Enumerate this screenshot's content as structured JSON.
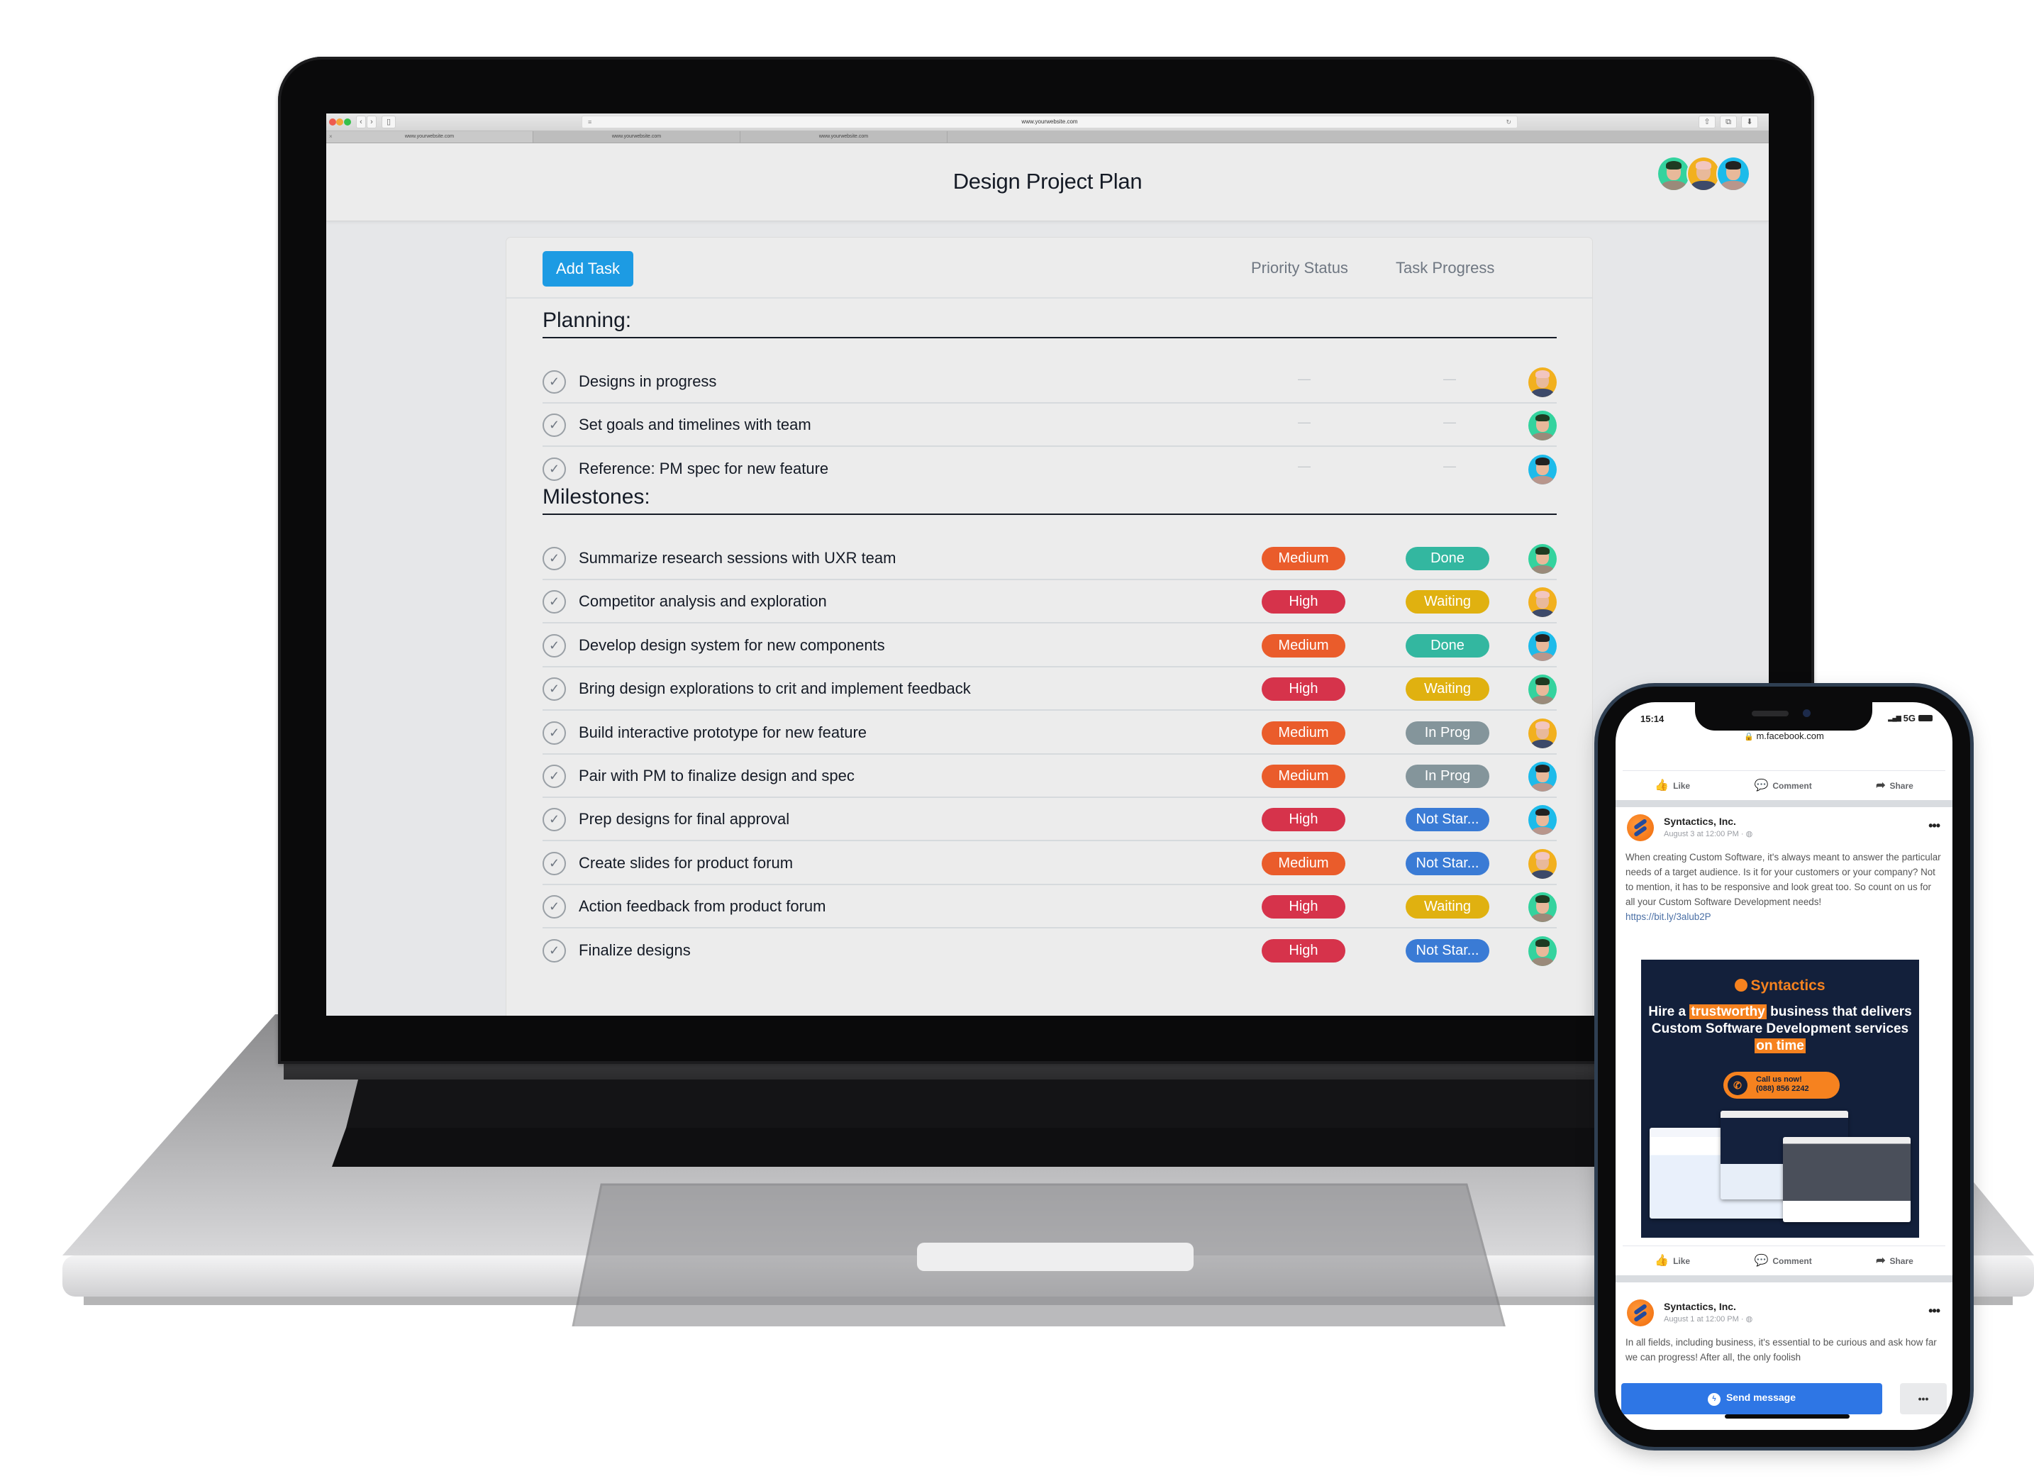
{
  "browser": {
    "address": "www.yourwebsite.com",
    "tabs": [
      {
        "label": "www.yourwebsite.com",
        "active": true
      },
      {
        "label": "www.yourwebsite.com",
        "active": false
      },
      {
        "label": "www.yourwebsite.com",
        "active": false
      }
    ],
    "icons": {
      "back": "‹",
      "forward": "›",
      "sidebar": "▯",
      "reader": "≡",
      "reload": "↻",
      "share": "⇧",
      "tabs": "⧉",
      "download": "⬇",
      "tab_close": "×"
    }
  },
  "app": {
    "title": "Design Project Plan",
    "add_task_label": "Add Task",
    "columns": {
      "priority": "Priority Status",
      "progress": "Task Progress"
    },
    "empty_placeholder": "—",
    "check_glyph": "✓",
    "colors": {
      "accent": "#1d9be3",
      "priority": {
        "Medium": "#ea5c2b",
        "High": "#d6334b"
      },
      "progress": {
        "Done": "#33b7a0",
        "Waiting": "#e0b110",
        "In Prog": "#84959b",
        "Not Star...": "#3a7bd5"
      }
    },
    "team": [
      {
        "id": "green",
        "bg": "#34d39e",
        "hair": "#1f3b22",
        "shirt": "#9a8a7a"
      },
      {
        "id": "yellow",
        "bg": "#f2b01e",
        "hair": "#f2c6c0",
        "shirt": "#3d4a6a"
      },
      {
        "id": "blue",
        "bg": "#1dbbea",
        "hair": "#222222",
        "shirt": "#b8968c"
      }
    ],
    "sections": [
      {
        "title": "Planning:",
        "tasks": [
          {
            "name": "Designs in progress",
            "priority": null,
            "progress": null,
            "assignee": "yellow"
          },
          {
            "name": "Set goals and timelines with team",
            "priority": null,
            "progress": null,
            "assignee": "green"
          },
          {
            "name": "Reference: PM spec for new feature",
            "priority": null,
            "progress": null,
            "assignee": "blue"
          }
        ]
      },
      {
        "title": "Milestones:",
        "tasks": [
          {
            "name": "Summarize research sessions with UXR team",
            "priority": "Medium",
            "progress": "Done",
            "assignee": "green"
          },
          {
            "name": "Competitor analysis and exploration",
            "priority": "High",
            "progress": "Waiting",
            "assignee": "yellow"
          },
          {
            "name": "Develop design system for new components",
            "priority": "Medium",
            "progress": "Done",
            "assignee": "blue"
          },
          {
            "name": "Bring design explorations to crit and implement feedback",
            "priority": "High",
            "progress": "Waiting",
            "assignee": "green"
          },
          {
            "name": "Build interactive prototype for new feature",
            "priority": "Medium",
            "progress": "In Prog",
            "assignee": "yellow"
          },
          {
            "name": "Pair with PM to finalize design and spec",
            "priority": "Medium",
            "progress": "In Prog",
            "assignee": "blue"
          },
          {
            "name": "Prep designs for final approval",
            "priority": "High",
            "progress": "Not Star...",
            "assignee": "blue"
          },
          {
            "name": "Create slides for product forum",
            "priority": "Medium",
            "progress": "Not Star...",
            "assignee": "yellow"
          },
          {
            "name": "Action feedback from product forum",
            "priority": "High",
            "progress": "Waiting",
            "assignee": "green"
          },
          {
            "name": "Finalize designs",
            "priority": "High",
            "progress": "Not Star...",
            "assignee": "green"
          }
        ]
      }
    ]
  },
  "phone": {
    "time": "15:14",
    "network": "5G",
    "url": "m.facebook.com",
    "lock_icon": "🔒",
    "actions": {
      "like": "Like",
      "comment": "Comment",
      "share": "Share"
    },
    "action_icons": {
      "like": "👍",
      "comment": "💬",
      "share": "➦"
    },
    "posts": [
      {
        "page": "Syntactics, Inc.",
        "time": "August 3 at 12:00 PM · ",
        "text": "When creating Custom Software, it's always meant to answer the particular needs of a target audience. Is it for your customers or your company? Not to mention, it has to be responsive and look great too. So count on us for all your Custom Software Development needs!",
        "link": "https://bit.ly/3alub2P"
      },
      {
        "page": "Syntactics, Inc.",
        "time": "August 1 at 12:00 PM · ",
        "text": "In all fields, including business, it's essential to be curious and ask how far we can progress! After all, the only foolish"
      }
    ],
    "more_glyph": "•••",
    "ad": {
      "brand": "Syntactics",
      "headline_pre": "Hire a ",
      "headline_hl1": "trustworthy",
      "headline_mid": " business that delivers Custom Software Development services ",
      "headline_hl2": "on time",
      "cta_line1": "Call us now!",
      "cta_line2": "(088) 856 2242",
      "brand_color": "#f6821f",
      "bg_color": "#13203b"
    },
    "send_message_label": "Send message",
    "send_more_label": "•••"
  }
}
